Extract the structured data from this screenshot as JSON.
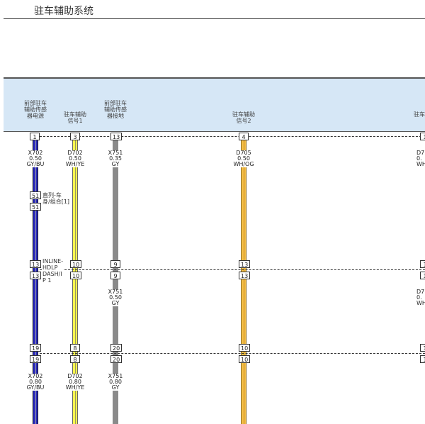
{
  "title": "驻车辅助系统",
  "header_labels": [
    "前部驻车\n辅助传感\n器电源",
    "驻车辅助\n信号1",
    "前部驻车\n辅助传感\n器接地",
    "驻车辅助\n信号2",
    "驻车"
  ],
  "top_pins": [
    "1",
    "3",
    "13",
    "4",
    "1"
  ],
  "wire_labels_top": [
    "X702\n0.50\nGY/BU",
    "D702\n0.50\nWH/YE",
    "X751\n0.35\nGY",
    "D705\n0.50\nWH/OG",
    "D7\n0.\nWH"
  ],
  "inline_51": {
    "pin_top": "51",
    "pin_bottom": "51",
    "label": "直列-车\n身/组合[1]"
  },
  "row2_pins_top": [
    "13",
    "10",
    "9",
    "13",
    "1"
  ],
  "row2_pins_bottom": [
    "13",
    "10",
    "9",
    "13",
    "1"
  ],
  "row2_connector_label": "INLINE-\nHDLP\nDASH/I\nP 1",
  "wire_labels_mid": [
    "X751\n0.50\nGY",
    "D7\n0.\nWH"
  ],
  "row3_pins_top": [
    "19",
    "8",
    "20",
    "10",
    "1"
  ],
  "row3_pins_bottom": [
    "19",
    "8",
    "20",
    "10",
    "1"
  ],
  "wire_labels_bottom": [
    "X702\n0.80\nGY/BU",
    "D702\n0.80\nWH/YE",
    "X751\n0.80\nGY"
  ]
}
